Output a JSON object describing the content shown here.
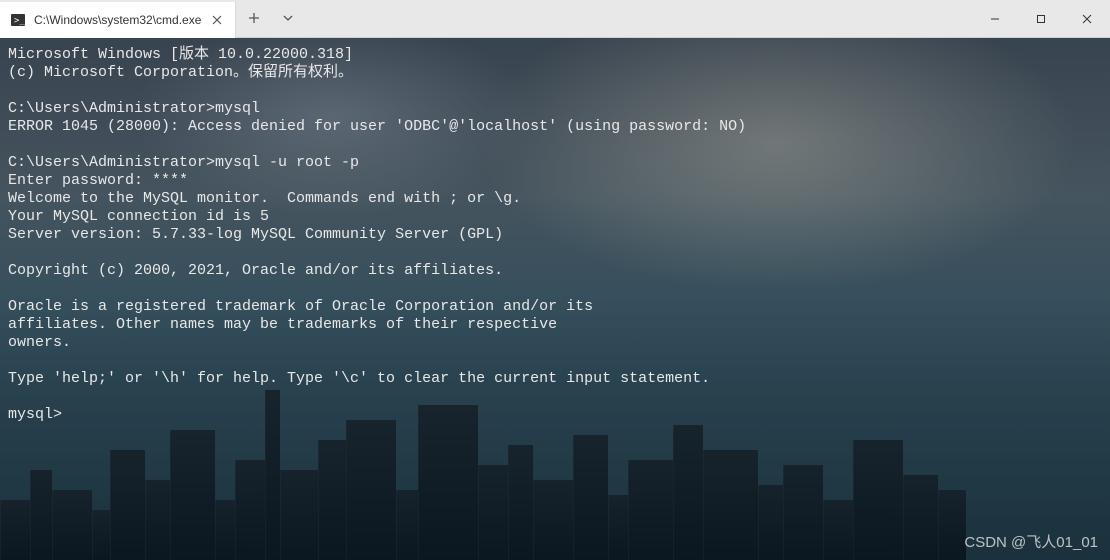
{
  "window": {
    "tab_title": "C:\\Windows\\system32\\cmd.exe"
  },
  "terminal": {
    "lines": [
      "Microsoft Windows [版本 10.0.22000.318]",
      "(c) Microsoft Corporation。保留所有权利。",
      "",
      "C:\\Users\\Administrator>mysql",
      "ERROR 1045 (28000): Access denied for user 'ODBC'@'localhost' (using password: NO)",
      "",
      "C:\\Users\\Administrator>mysql -u root -p",
      "Enter password: ****",
      "Welcome to the MySQL monitor.  Commands end with ; or \\g.",
      "Your MySQL connection id is 5",
      "Server version: 5.7.33-log MySQL Community Server (GPL)",
      "",
      "Copyright (c) 2000, 2021, Oracle and/or its affiliates.",
      "",
      "Oracle is a registered trademark of Oracle Corporation and/or its",
      "affiliates. Other names may be trademarks of their respective",
      "owners.",
      "",
      "Type 'help;' or '\\h' for help. Type '\\c' to clear the current input statement.",
      "",
      "mysql>"
    ]
  },
  "watermark": "CSDN @飞人01_01"
}
